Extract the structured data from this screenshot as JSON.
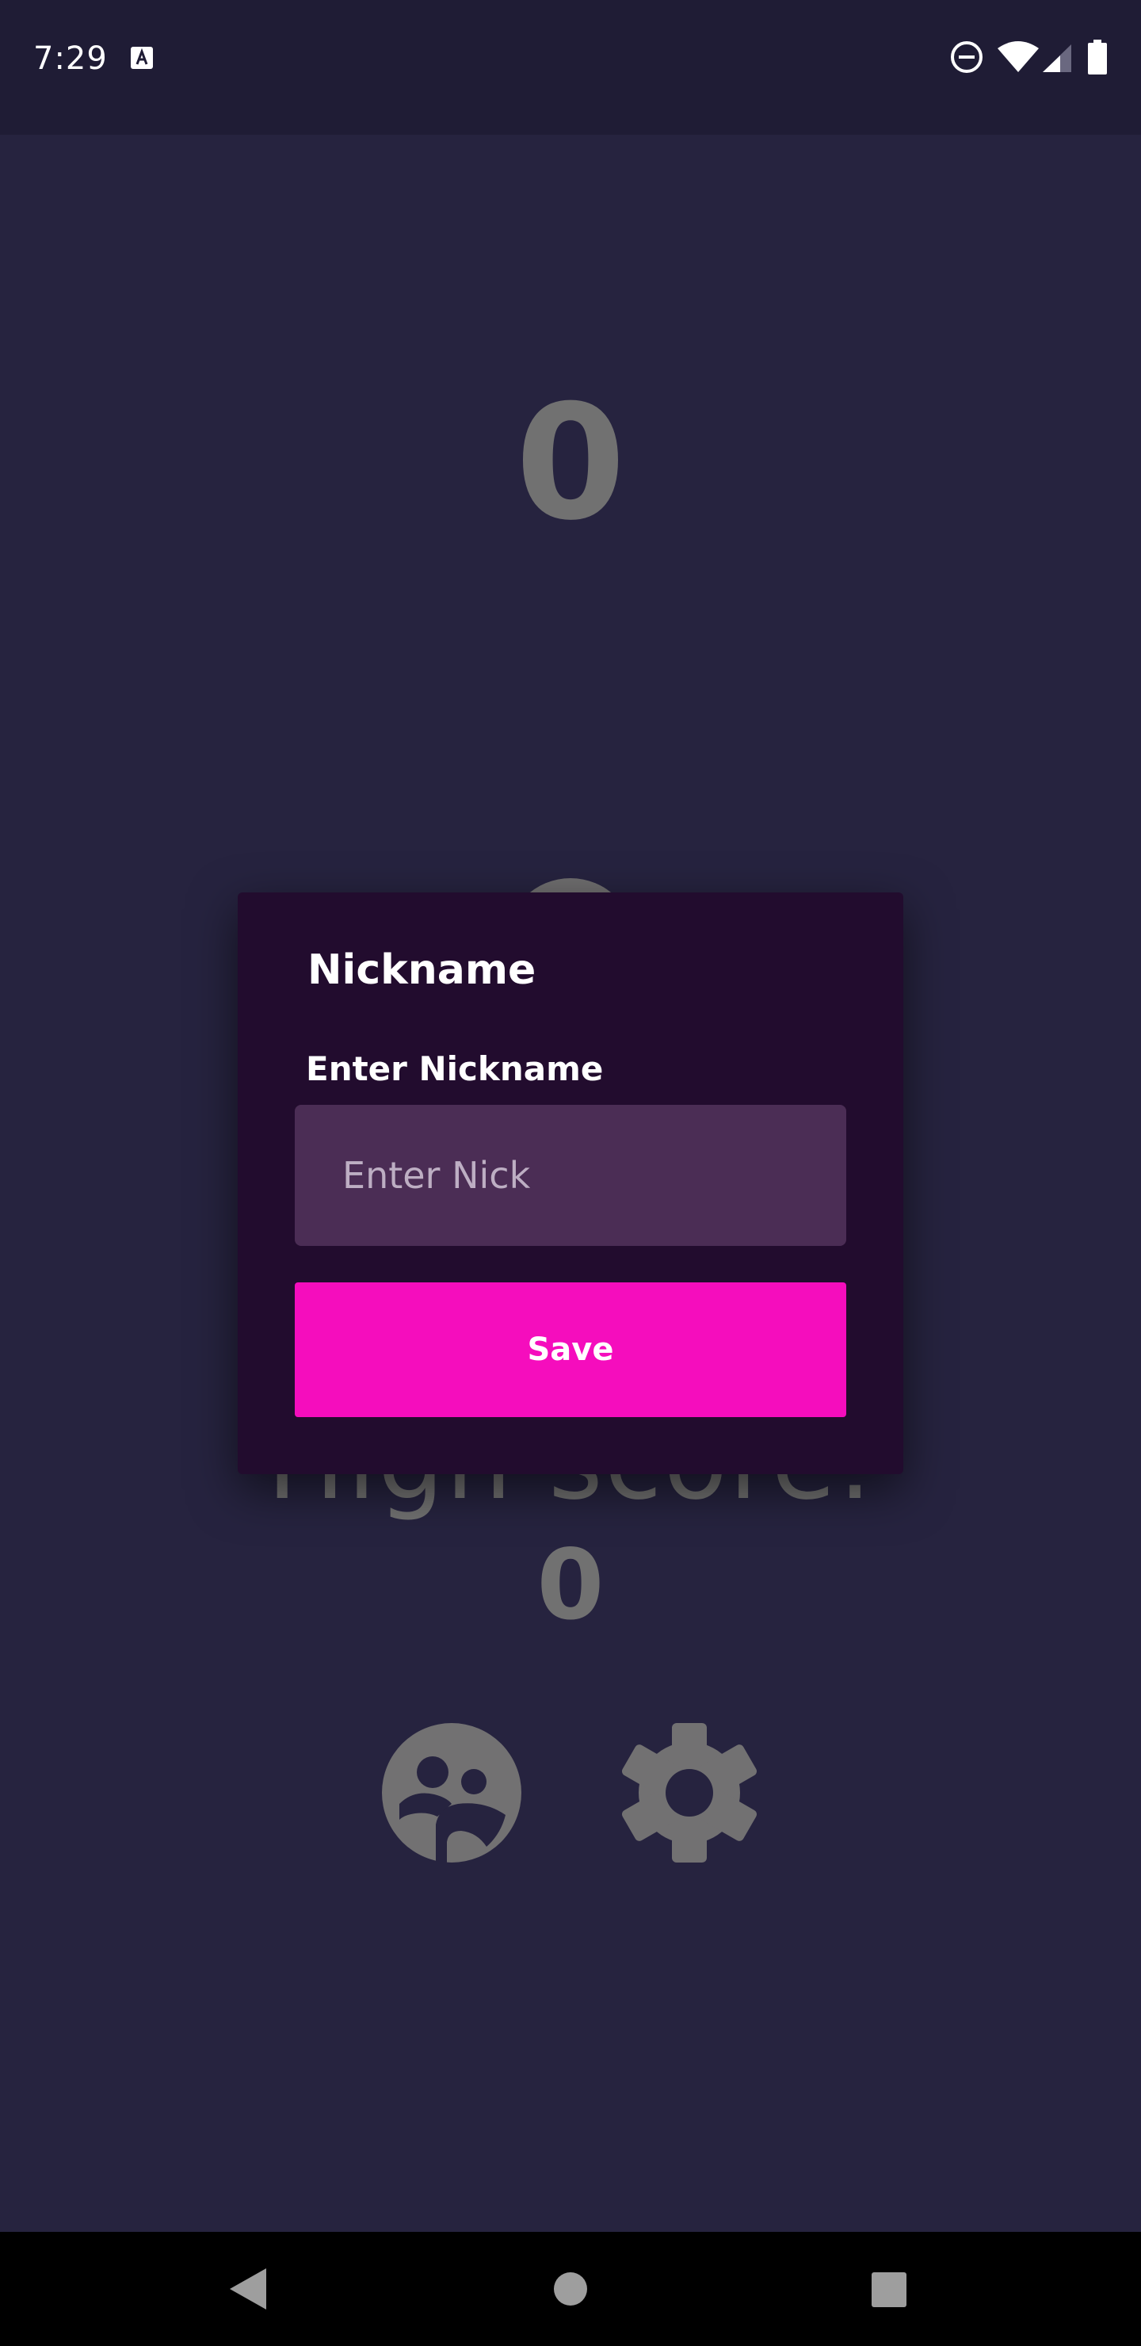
{
  "status_bar": {
    "time": "7:29",
    "icons": [
      "a-notification-icon",
      "do-not-disturb-icon",
      "wifi-icon",
      "cell-signal-icon",
      "battery-icon"
    ]
  },
  "game": {
    "score": "0",
    "high_score_label": "High score:",
    "high_score_value": "0",
    "buttons": [
      "leaderboard-icon",
      "settings-icon"
    ]
  },
  "dialog": {
    "title": "Nickname",
    "field_label": "Enter Nickname",
    "input_value": "",
    "input_placeholder": "Enter Nick",
    "save_label": "Save"
  },
  "colors": {
    "background": "#26233f",
    "status_bar": "#1f1c35",
    "dialog": "#220c2e",
    "input": "#4b2d55",
    "accent": "#f50dbd",
    "dim_text": "#717171"
  },
  "nav_bar": {
    "icons": [
      "back-icon",
      "home-icon",
      "recents-icon"
    ]
  }
}
